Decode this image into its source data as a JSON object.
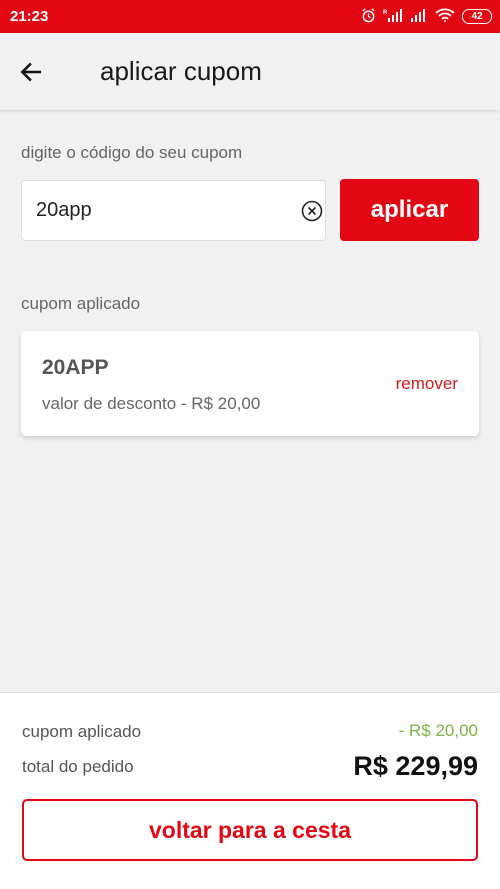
{
  "status_bar": {
    "time": "21:23",
    "battery": "42"
  },
  "header": {
    "title": "aplicar cupom",
    "back_icon": "arrow-left-icon"
  },
  "coupon_form": {
    "label": "digite o código do seu cupom",
    "input_value": "20app",
    "clear_icon": "clear-circle-icon",
    "apply_label": "aplicar"
  },
  "applied_section": {
    "label": "cupom aplicado",
    "code": "20APP",
    "description": "valor de desconto - R$ 20,00",
    "remove_label": "remover"
  },
  "summary": {
    "coupon_label": "cupom aplicado",
    "coupon_value": "- R$ 20,00",
    "total_label": "total do pedido",
    "total_value": "R$ 229,99",
    "back_button_label": "voltar para a cesta"
  },
  "colors": {
    "brand_red": "#e30613",
    "discount_green": "#7cb342",
    "background": "#f1f1f1"
  }
}
